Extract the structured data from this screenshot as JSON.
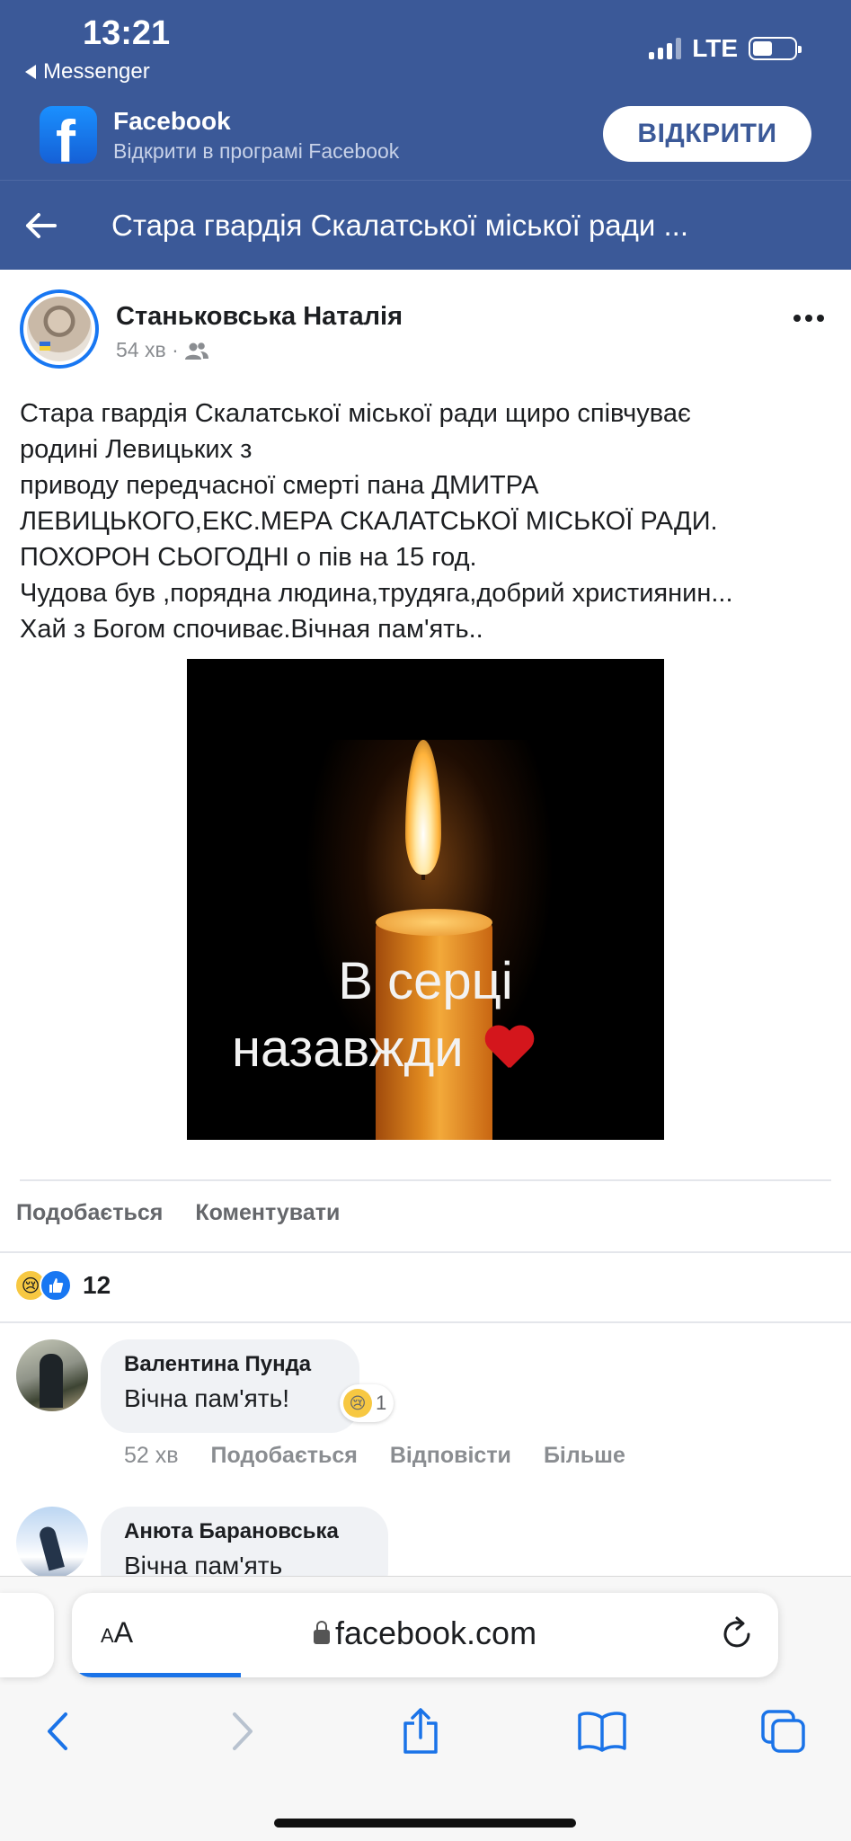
{
  "status_bar": {
    "time": "13:21",
    "back_app_label": "Messenger",
    "network": "LTE",
    "battery_level": 0.48
  },
  "app_banner": {
    "app_name": "Facebook",
    "subtitle": "Відкрити в програмі Facebook",
    "open_button": "ВІДКРИТИ",
    "logo_letter": "f"
  },
  "nav": {
    "title": "Стара гвардія Скалатської міської ради ..."
  },
  "post": {
    "author": "Станьковська Наталія",
    "time": "54 хв ·",
    "lines": [
      "Стара гвардія Скалатської міської ради щиро співчуває",
      "родині Левицьких з",
      "приводу передчасної смерті пана ДМИТРА",
      "ЛЕВИЦЬКОГО,ЕКС.МЕРА СКАЛАТСЬКОЇ МІСЬКОЇ РАДИ.",
      "ПОХОРОН СЬОГОДНІ о пів на 15 год.",
      "Чудова був ,порядна людина,трудяга,добрий християнин...",
      "Хай з Богом спочиває.Вічная пам'ять.."
    ],
    "image_text_line1": "В серці",
    "image_text_line2": "назавжди",
    "like_action": "Подобається",
    "comment_action": "Коментувати",
    "reaction_count": "12"
  },
  "comments": [
    {
      "author": "Валентина Пунда",
      "text": "Вічна пам'ять!",
      "reaction_count": "1",
      "time": "52 хв",
      "like": "Подобається",
      "reply": "Відповісти",
      "more": "Більше"
    },
    {
      "author": "Анюта Барановська",
      "text": "Вічна пам'ять"
    }
  ],
  "browser": {
    "text_size_label": "AA",
    "url": "facebook.com"
  },
  "colors": {
    "facebook_blue": "#3b5998",
    "link_blue": "#1877f2",
    "safari_blue": "#1a73e8"
  }
}
